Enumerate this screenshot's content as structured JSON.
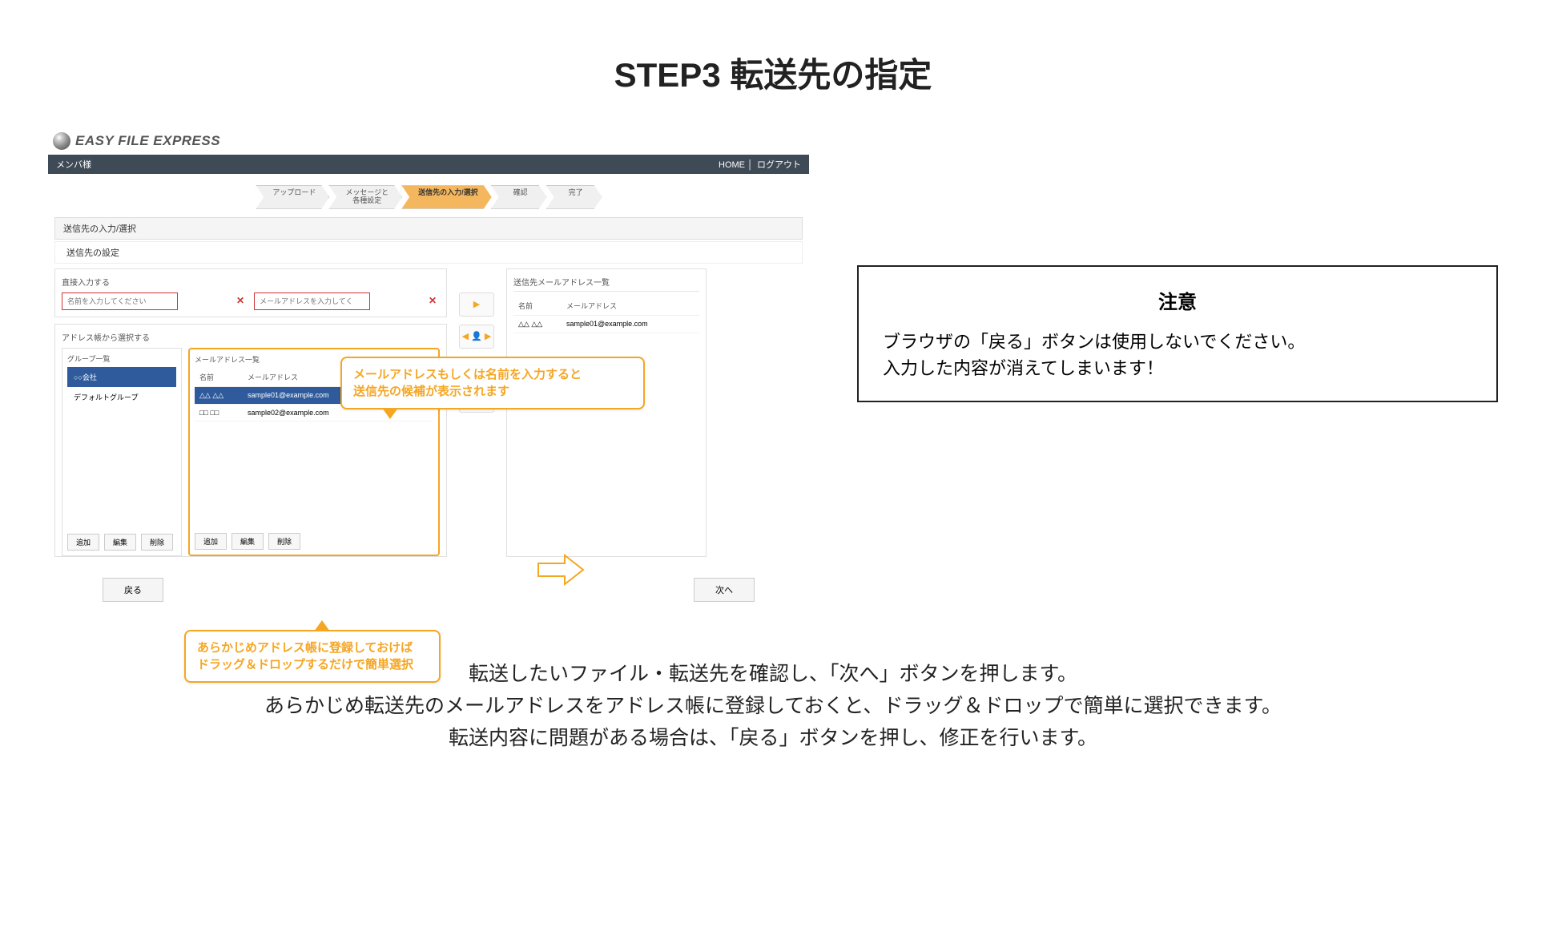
{
  "page_title": "STEP3 転送先の指定",
  "app": {
    "logo": "EASY FILE EXPRESS",
    "member_label": "メンバ様",
    "nav": {
      "home": "HOME",
      "logout": "ログアウト"
    },
    "steps": [
      "アップロード",
      "メッセージと\n各種設定",
      "送信先の入力/選択",
      "確認",
      "完了"
    ],
    "active_step_index": 2,
    "section_title": "送信先の入力/選択",
    "section_sub": "送信先の設定",
    "direct_input": {
      "title": "直接入力する",
      "name_placeholder": "名前を入力してください",
      "mail_placeholder": "メールアドレスを入力してください"
    },
    "address_book": {
      "title": "アドレス帳から選択する",
      "group_col_title": "グループ一覧",
      "addr_col_title": "メールアドレス一覧",
      "header_name": "名前",
      "header_mail": "メールアドレス",
      "groups": [
        {
          "label": "○○会社",
          "active": true
        },
        {
          "label": "デフォルトグループ",
          "active": false
        }
      ],
      "addresses": [
        {
          "name": "△△ △△",
          "mail": "sample01@example.com",
          "selected": true
        },
        {
          "name": "□□ □□",
          "mail": "sample02@example.com",
          "selected": false
        }
      ],
      "btn_add": "追加",
      "btn_edit": "編集",
      "btn_delete": "削除"
    },
    "mid_buttons": [
      "→",
      "⇄",
      "⇄",
      "←"
    ],
    "dest_list": {
      "title": "送信先メールアドレス一覧",
      "header_name": "名前",
      "header_mail": "メールアドレス",
      "rows": [
        {
          "name": "△△ △△",
          "mail": "sample01@example.com"
        }
      ]
    },
    "back_btn": "戻る",
    "next_btn": "次へ"
  },
  "callouts": {
    "top": "メールアドレスもしくは名前を入力すると\n送信先の候補が表示されます",
    "bottom": "あらかじめアドレス帳に登録しておけば\nドラッグ＆ドロップするだけで簡単選択"
  },
  "notice": {
    "title": "注意",
    "body": "ブラウザの「戻る」ボタンは使用しないでください。\n入力した内容が消えてしまいます！"
  },
  "description": "転送したいファイル・転送先を確認し、「次へ」ボタンを押します。\nあらかじめ転送先のメールアドレスをアドレス帳に登録しておくと、ドラッグ＆ドロップで簡単に選択できます。\n転送内容に問題がある場合は、「戻る」ボタンを押し、修正を行います。"
}
